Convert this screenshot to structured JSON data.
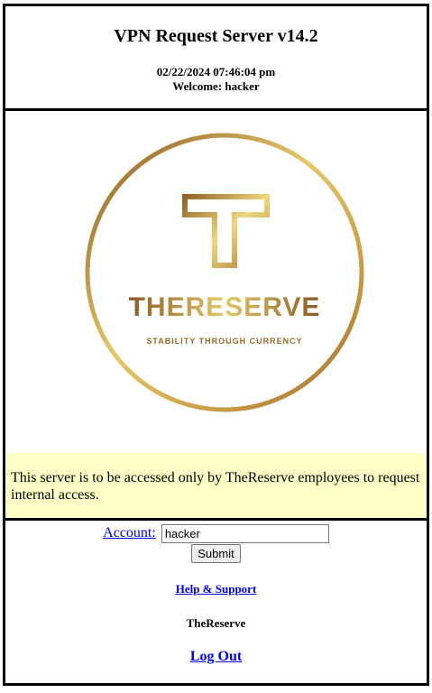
{
  "header": {
    "title": "VPN Request Server v14.2",
    "datetime": "02/22/2024 07:46:04 pm",
    "welcome": "Welcome: hacker"
  },
  "logo": {
    "name": "THERESERVE",
    "tagline": "STABILITY THROUGH CURRENCY",
    "gold_dark": "#8a5a22",
    "gold_light": "#e6c86a"
  },
  "notice": {
    "text": "This server is to be accessed only by TheReserve employees to request internal access.",
    "background": "#ffffc8"
  },
  "form": {
    "account_label": "Account:",
    "account_value": "hacker",
    "submit_label": "Submit"
  },
  "footer": {
    "help_label": "Help & Support",
    "org_name": "TheReserve",
    "logout_label": "Log Out"
  },
  "colors": {
    "link": "#0000ee",
    "border": "#000000"
  }
}
